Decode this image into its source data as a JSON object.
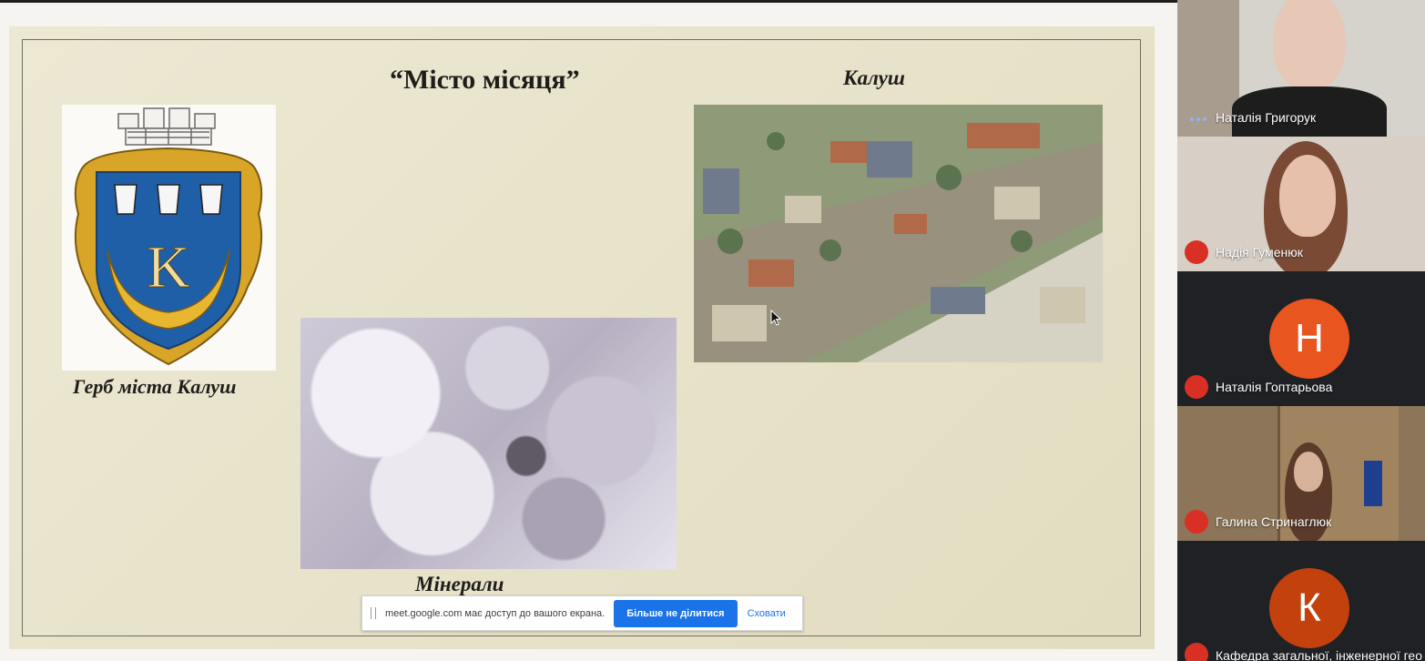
{
  "slide": {
    "title": "“Місто місяця”",
    "city_name": "Калуш",
    "coat_caption": "Герб міста Калуш",
    "coat_letter": "K",
    "minerals_caption": "Мінерали"
  },
  "share_bar": {
    "message": "meet.google.com має доступ до вашого екрана.",
    "stop_button": "Більше не ділитися",
    "hide_link": "Сховати"
  },
  "participants": [
    {
      "name": "Наталія Григорук",
      "status": "speaking"
    },
    {
      "name": "Надія Гуменюк",
      "status": "muted"
    },
    {
      "name": "Наталія Гоптарьова",
      "status": "muted",
      "initial": "Н",
      "avatar_color": "#e8551f"
    },
    {
      "name": "Галина Стринаглюк",
      "status": "muted"
    },
    {
      "name": "Кафедра загальної, інженерної гео",
      "status": "muted",
      "initial": "К",
      "avatar_color": "#c2410c"
    }
  ],
  "colors": {
    "accent": "#1a73e8",
    "mic_off": "#d93025",
    "tile_bg": "#3c4043"
  },
  "icons": [
    "mic-off-icon",
    "speaking-dots-icon",
    "cursor-icon",
    "drag-grip-icon"
  ]
}
